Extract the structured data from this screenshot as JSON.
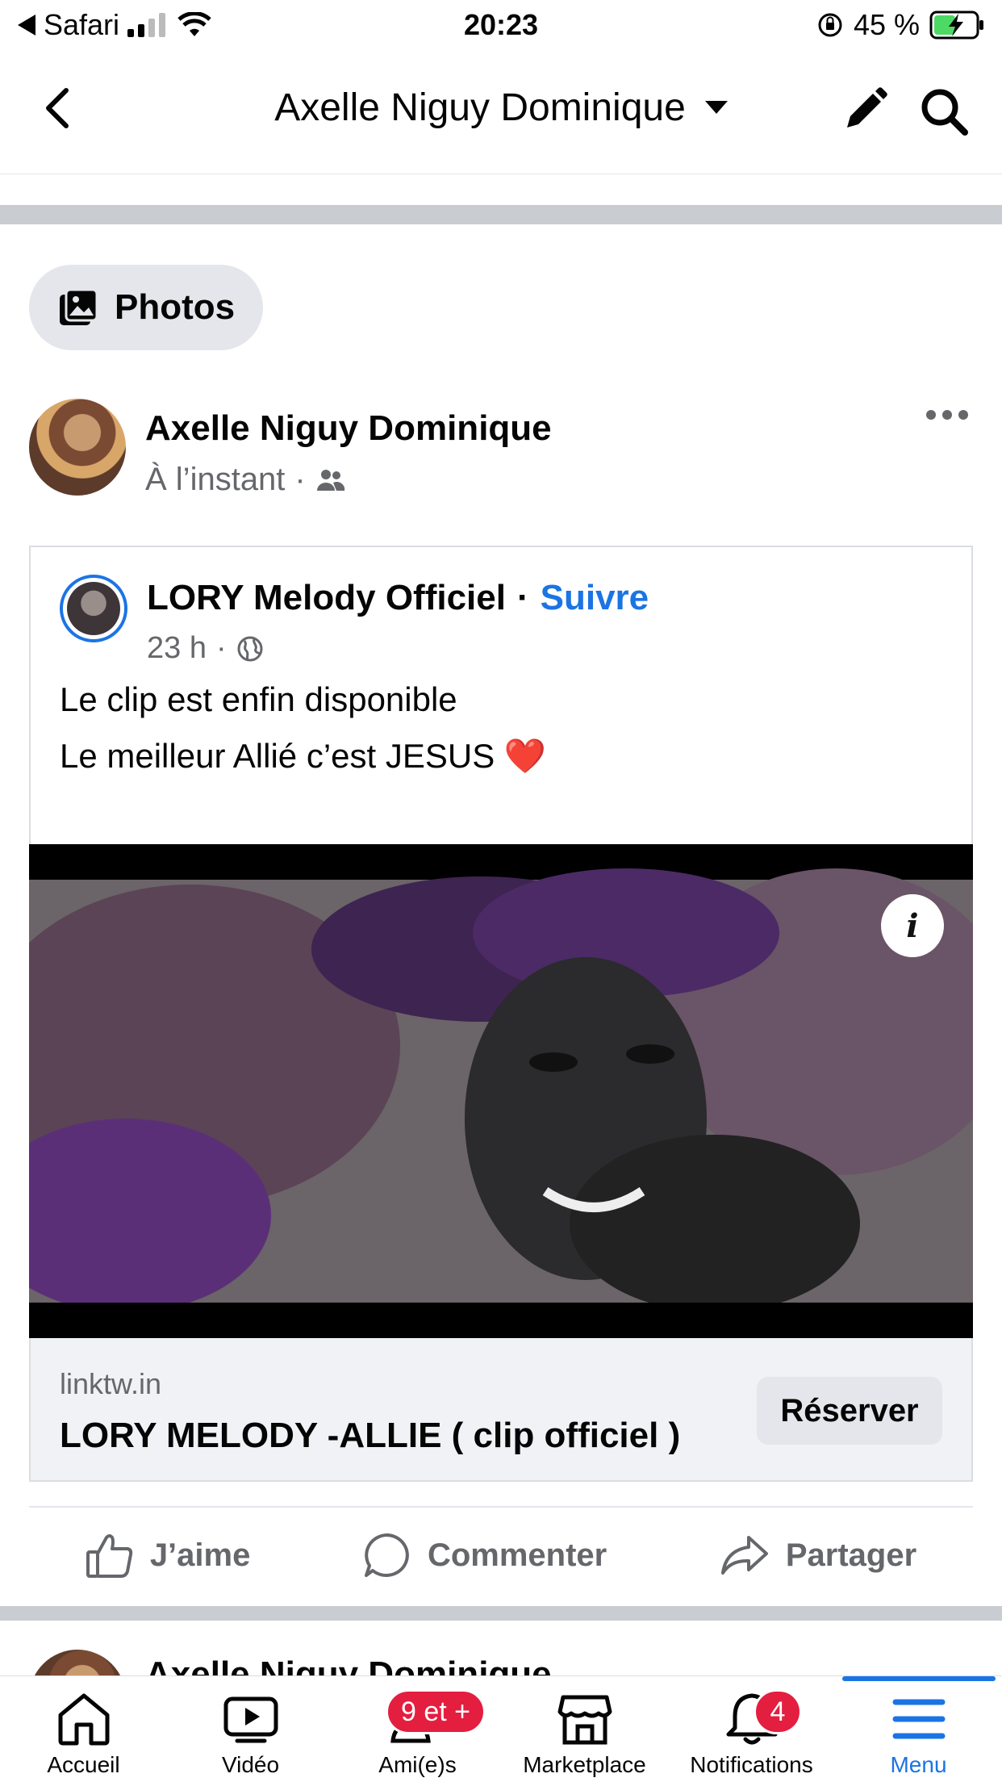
{
  "statusbar": {
    "carrier": "Safari",
    "time": "20:23",
    "battery": "45 %"
  },
  "nav": {
    "title": "Axelle Niguy Dominique"
  },
  "photos_chip": {
    "label": "Photos"
  },
  "post": {
    "author": "Axelle Niguy Dominique",
    "time": "À l’instant",
    "shared": {
      "page_name": "LORY Melody Officiel",
      "separator": "·",
      "follow_label": "Suivre",
      "time": "23 h",
      "text_line1": "Le clip est enfin disponible",
      "text_line2": "Le meilleur Allié c’est JESUS ❤️",
      "link_domain": "linktw.in",
      "link_title": "LORY MELODY -ALLIE ( clip officiel )",
      "cta_label": "Réserver",
      "info_label": "i"
    },
    "actions": {
      "like": "J’aime",
      "comment": "Commenter",
      "share": "Partager"
    }
  },
  "next_post": {
    "author": "Axelle Niguy Dominique"
  },
  "tabbar": {
    "home": "Accueil",
    "video": "Vidéo",
    "friends": "Ami(e)s",
    "friends_badge": "9 et +",
    "marketplace": "Marketplace",
    "notifications": "Notifications",
    "notifications_badge": "4",
    "menu": "Menu"
  },
  "colors": {
    "accent": "#1b74e4",
    "badge": "#e41e3f",
    "battery": "#4cd964"
  }
}
